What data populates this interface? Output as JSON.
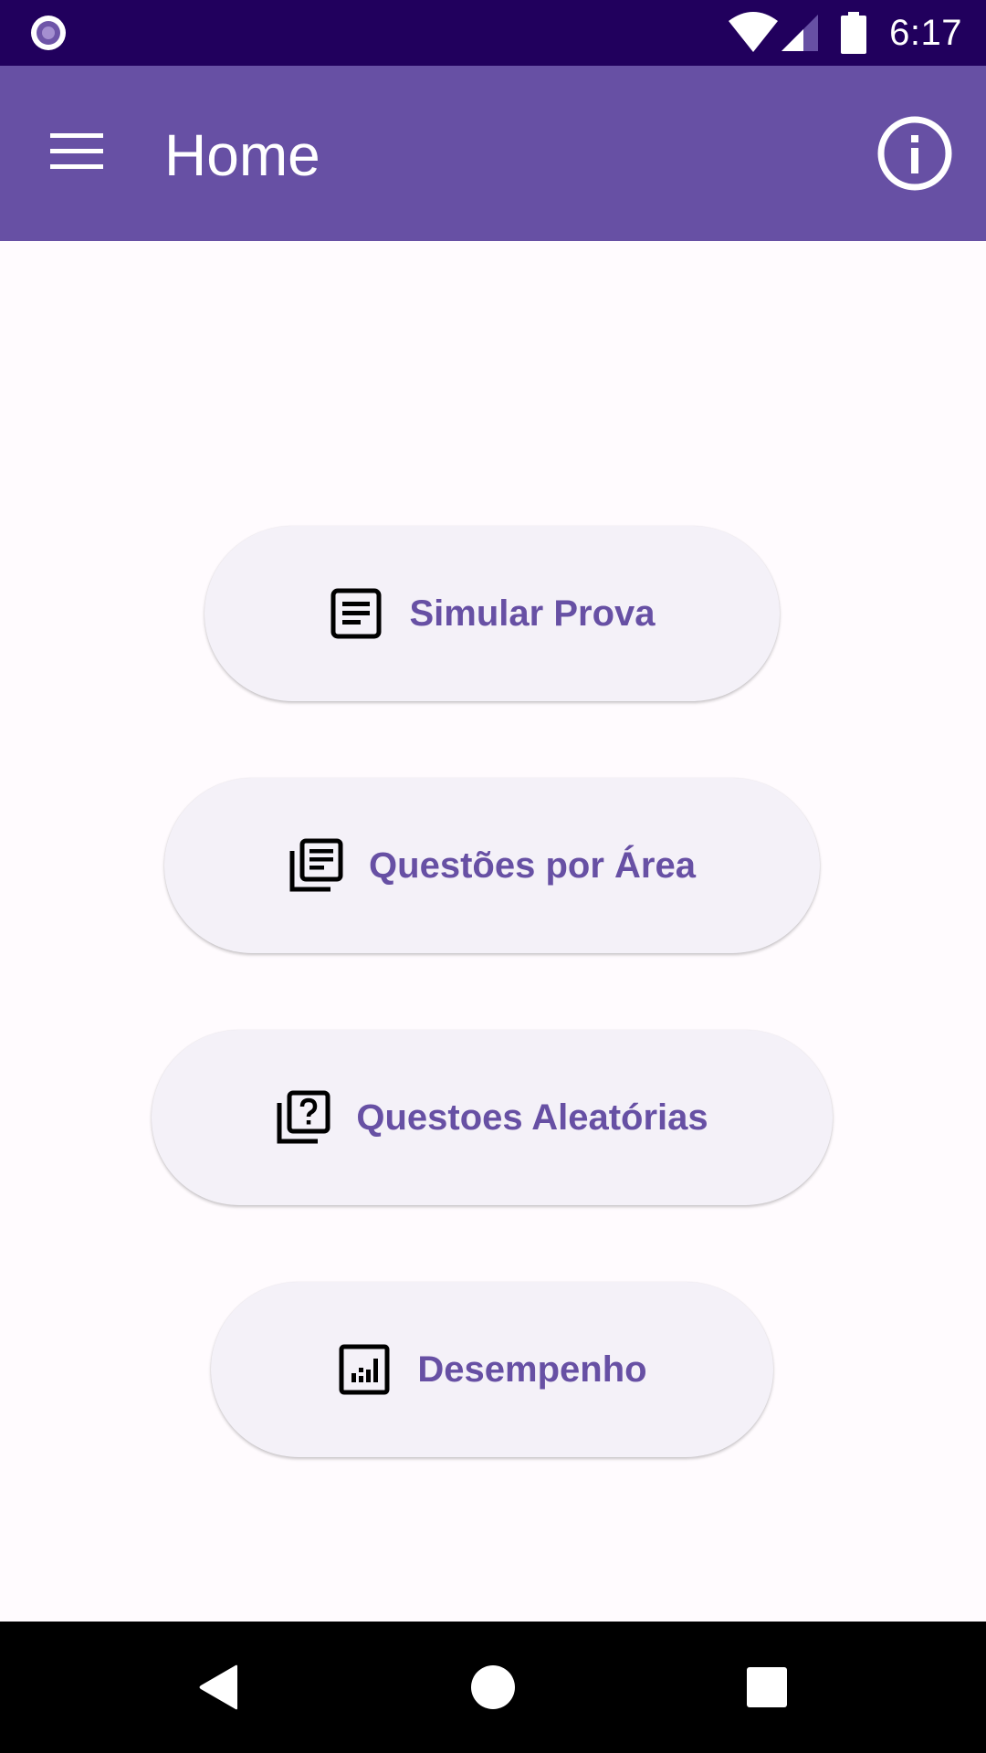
{
  "status_bar": {
    "time": "6:17",
    "icons": [
      "app-notification-icon",
      "wifi-icon",
      "signal-icon",
      "battery-icon"
    ]
  },
  "app_bar": {
    "title": "Home",
    "menu_icon": "menu-icon",
    "info_icon": "info-icon"
  },
  "buttons": [
    {
      "label": "Simular Prova",
      "icon": "article-icon"
    },
    {
      "label": "Questões por Área",
      "icon": "library-books-icon"
    },
    {
      "label": "Questoes Aleatórias",
      "icon": "quiz-icon"
    },
    {
      "label": "Desempenho",
      "icon": "analytics-icon"
    }
  ],
  "nav_bar": {
    "icons": [
      "back-icon",
      "home-icon",
      "recents-icon"
    ]
  },
  "colors": {
    "status_bar": "#21005D",
    "app_bar": "#6750A4",
    "button_background": "#F4F1F8",
    "button_text": "#6750A4",
    "background": "#FFFBFE",
    "nav_bar": "#000000"
  }
}
